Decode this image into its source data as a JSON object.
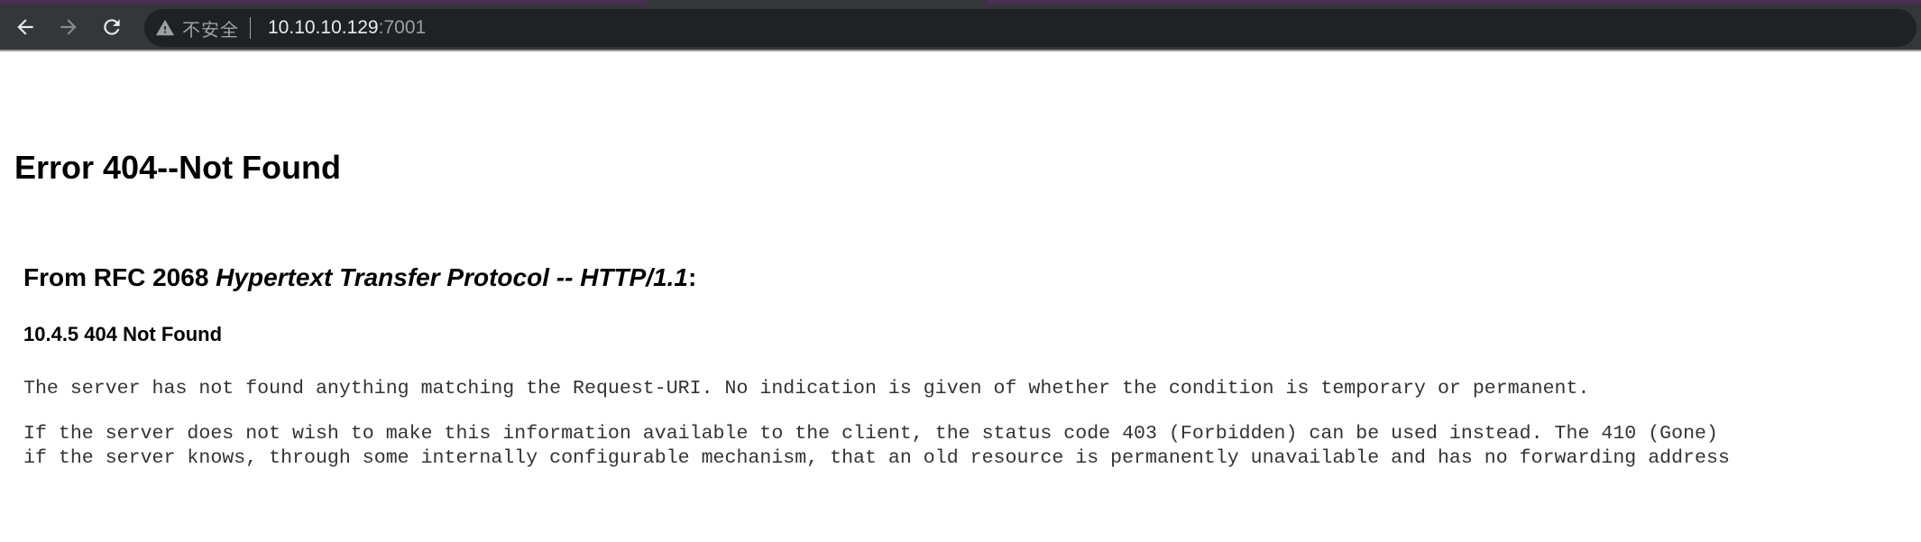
{
  "browser": {
    "colors": {
      "tabstrip": "#4a2f52",
      "toolbar": "#35363a",
      "omnibox": "#202124",
      "icon": "#e8eaed",
      "icon_disabled": "#8a8b8e"
    },
    "toolbar": {
      "back_icon": "arrow-left-icon",
      "forward_icon": "arrow-right-icon",
      "reload_icon": "reload-icon"
    },
    "omnibox": {
      "security_icon": "warning-triangle-icon",
      "security_text": "不安全",
      "url_host": "10.10.10.129",
      "url_port": ":7001"
    }
  },
  "page": {
    "title": "Error 404--Not Found",
    "rfc_heading": {
      "prefix": "From RFC 2068 ",
      "italic": "Hypertext Transfer Protocol -- HTTP/1.1",
      "suffix": ":"
    },
    "section_heading": "10.4.5 404 Not Found",
    "paragraphs": [
      "The server has not found anything matching the Request-URI. No indication is given of whether the condition is temporary or permanent.",
      "If the server does not wish to make this information available to the client, the status code 403 (Forbidden) can be used instead. The 410 (Gone)\nif the server knows, through some internally configurable mechanism, that an old resource is permanently unavailable and has no forwarding address"
    ]
  }
}
